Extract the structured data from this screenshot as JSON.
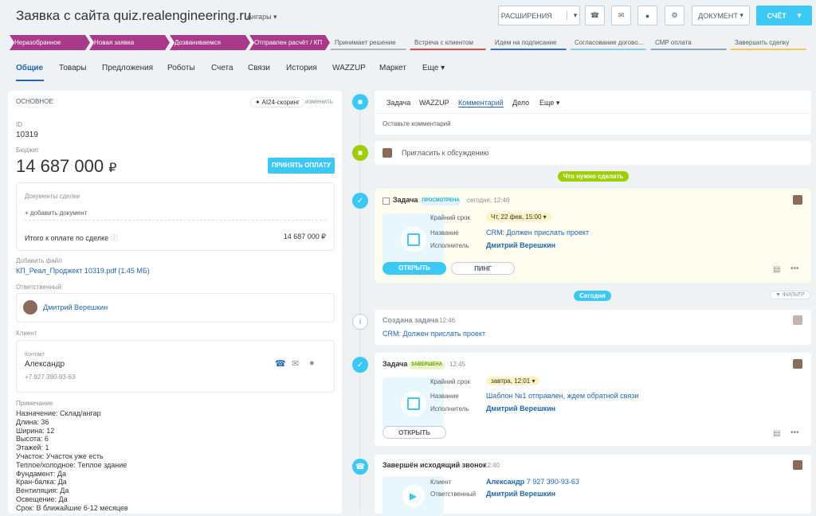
{
  "header": {
    "title": "Заявка с сайта quiz.realengineering.ru",
    "category": "Ангары",
    "ext_label": "РАСШИРЕНИЯ",
    "doc_label": "ДОКУМЕНТ",
    "invoice_label": "СЧЁТ"
  },
  "stages": [
    {
      "label": "Неразобранное",
      "state": "done"
    },
    {
      "label": "Новая заявка",
      "state": "done"
    },
    {
      "label": "Дозваниваемся",
      "state": "done"
    },
    {
      "label": "Отправлен расчёт / КП",
      "state": "done"
    },
    {
      "label": "Принимает решение",
      "state": "todo",
      "color": "#b5b5b5"
    },
    {
      "label": "Встреча с клиентом",
      "state": "todo",
      "color": "#d94c4c"
    },
    {
      "label": "Идем на подписание",
      "state": "todo",
      "color": "#3b6ec2"
    },
    {
      "label": "Согласование догово...",
      "state": "todo",
      "color": "#7fd2e8"
    },
    {
      "label": "СМР оплата",
      "state": "todo",
      "color": "#8ea6b8"
    },
    {
      "label": "Завершить сделку",
      "state": "todo",
      "color": "#f2c94c"
    }
  ],
  "tabs": [
    "Общие",
    "Товары",
    "Предложения",
    "Роботы",
    "Счета",
    "Связи",
    "История",
    "WAZZUP",
    "Маркет",
    "Еще"
  ],
  "left": {
    "section": "ОСНОВНОЕ",
    "ai_label": "AI24-скоринг",
    "edit_label": "изменить",
    "id_label": "ID",
    "id_value": "10319",
    "budget_label": "Бюджет",
    "budget_value": "14 687 000",
    "currency": "₽",
    "pay_button": "ПРИНЯТЬ ОПЛАТУ",
    "docs_label": "Документы сделки",
    "add_doc": "+ добавить документ",
    "total_label": "Итого к оплате по сделке",
    "total_value": "14 687 000 ₽",
    "file_label": "Добавить файл",
    "file_name": "КП_Реал_Проджект 10319.pdf (1.45 МБ)",
    "resp_label": "Ответственный",
    "resp_name": "Дмитрий Верешкин",
    "client_label": "Клиент",
    "contact_label": "Контакт",
    "contact_name": "Александр",
    "contact_phone": "+7 927 390-93-63",
    "note_label": "Примечание",
    "notes": [
      "Назначение: Склад/ангар",
      "Длина: 36",
      "Ширина: 12",
      "Высота: 6",
      "Этажей: 1",
      "Участок: Участок уже есть",
      "Теплое/холодное: Теплое здание",
      "Фундамент: Да",
      "Кран-балка: Да",
      "Вентиляция: Да",
      "Освещение: Да",
      "Срок: В ближайшие 6-12 месяцев"
    ]
  },
  "right": {
    "tabs": [
      "Задача",
      "WAZZUP",
      "Комментарий",
      "Дело",
      "Еще"
    ],
    "comment_placeholder": "Оставьте комментарий",
    "invite": "Пригласить к обсуждению",
    "todo_pill": "Что нужно сделать",
    "task1": {
      "title": "Задача",
      "badge": "ПРОСМОТРЕНА",
      "time": "сегодня, 12:46",
      "deadline_label": "Крайний срок",
      "deadline": "Чт, 22 фев, 15:00",
      "name_label": "Название",
      "name": "CRM: Должен прислать проект",
      "exec_label": "Исполнитель",
      "exec": "Дмитрий Верешкин",
      "open": "ОТКРЫТЬ",
      "ping": "ПИНГ"
    },
    "today_pill": "Сегодня",
    "filter": "ФИЛЬТР",
    "created": {
      "title": "Создана задача",
      "time": "12:46",
      "text": "CRM: Должен прислать проект"
    },
    "task2": {
      "title": "Задача",
      "badge": "ЗАВЕРШЕНА",
      "time": "12:45",
      "deadline_label": "Крайний срок",
      "deadline": "завтра, 12:01",
      "name_label": "Название",
      "name": "Шаблон №1 отправлен, ждем обратной связи",
      "exec_label": "Исполнитель",
      "exec": "Дмитрий Верешкин",
      "open": "ОТКРЫТЬ"
    },
    "call": {
      "title": "Завершён исходящий звонок",
      "time": "12:40",
      "client_label": "Клиент",
      "client": "Александр",
      "client_phone": "7 927 390-93-63",
      "resp_label": "Ответственный",
      "resp": "Дмитрий Верешкин"
    }
  }
}
